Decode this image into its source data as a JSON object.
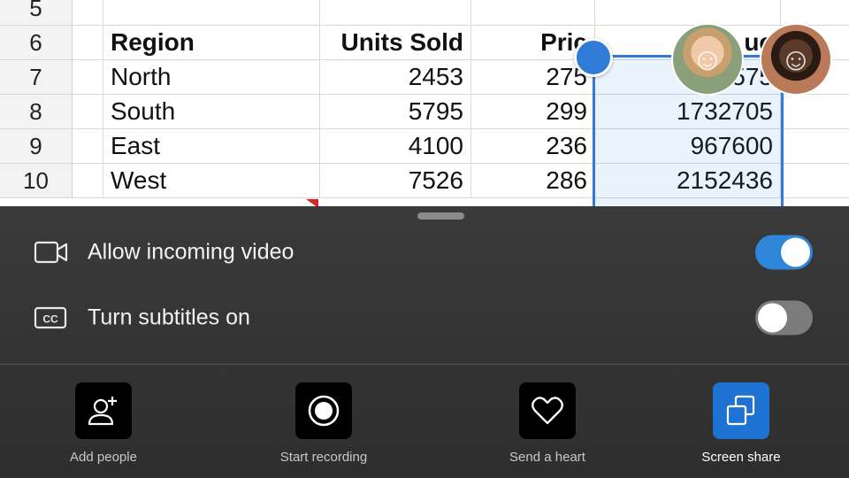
{
  "sheet": {
    "rows": [
      {
        "num": "5",
        "region": "",
        "units": "",
        "price": "",
        "revenue": ""
      },
      {
        "num": "6",
        "region": "Region",
        "units": "Units Sold",
        "price": "Pric",
        "revenue": "R    uc"
      },
      {
        "num": "7",
        "region": "North",
        "units": "2453",
        "price": "275",
        "revenue": "  575"
      },
      {
        "num": "8",
        "region": "South",
        "units": "5795",
        "price": "299",
        "revenue": "1732705"
      },
      {
        "num": "9",
        "region": "East",
        "units": "4100",
        "price": "236",
        "revenue": "967600"
      },
      {
        "num": "10",
        "region": "West",
        "units": "7526",
        "price": "286",
        "revenue": "2152436"
      }
    ]
  },
  "participants": [
    {
      "name": "participant-1",
      "icon": "person-avatar"
    },
    {
      "name": "participant-2",
      "icon": "person-avatar"
    }
  ],
  "options": {
    "video": {
      "label": "Allow incoming video",
      "icon": "video-camera-icon",
      "enabled": true
    },
    "subtitles": {
      "label": "Turn subtitles on",
      "icon": "closed-captions-icon",
      "enabled": false
    }
  },
  "actions": [
    {
      "label": "Add people",
      "icon": "add-person-icon"
    },
    {
      "label": "Start recording",
      "icon": "record-icon"
    },
    {
      "label": "Send a heart",
      "icon": "heart-icon"
    },
    {
      "label": "Screen share",
      "icon": "screen-share-icon",
      "accent": "#1e72d1"
    }
  ],
  "colors": {
    "accent": "#2d86d8",
    "toggle_off": "#7c7c7c",
    "selection": "#2f7bd6"
  }
}
